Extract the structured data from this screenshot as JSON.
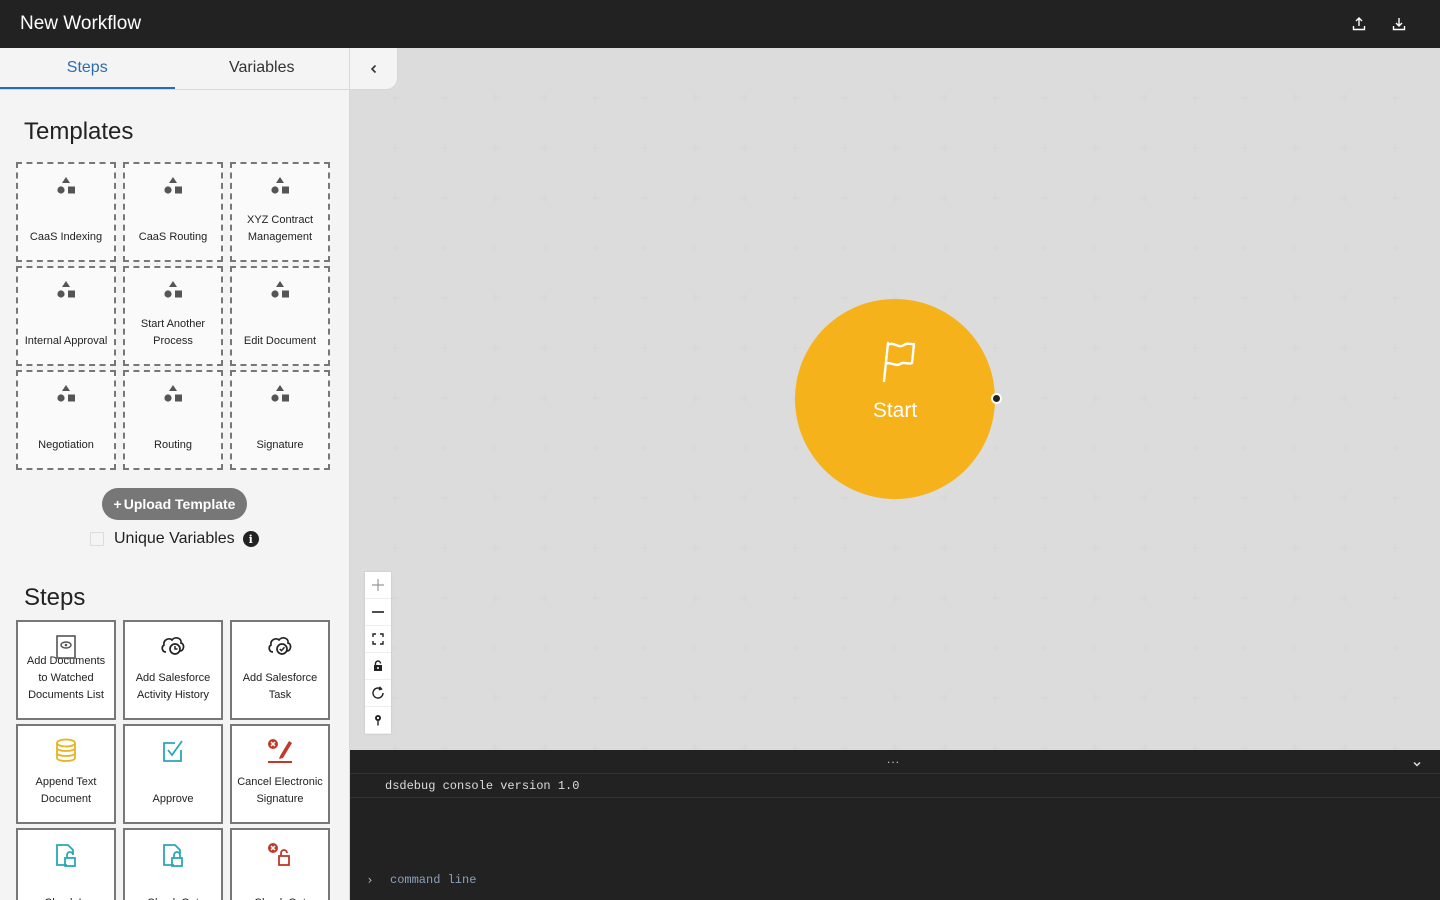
{
  "header": {
    "title": "New Workflow",
    "export_icon": "upload-icon",
    "import_icon": "download-icon"
  },
  "sidebar": {
    "tabs": [
      {
        "label": "Steps",
        "active": true
      },
      {
        "label": "Variables",
        "active": false
      }
    ],
    "templates_title": "Templates",
    "templates": [
      {
        "label": "CaaS Indexing",
        "icon": "shapes-icon"
      },
      {
        "label": "CaaS Routing",
        "icon": "shapes-icon"
      },
      {
        "label": "XYZ Contract Management",
        "icon": "shapes-icon"
      },
      {
        "label": "Internal Approval",
        "icon": "shapes-icon"
      },
      {
        "label": "Start Another Process",
        "icon": "shapes-icon"
      },
      {
        "label": "Edit Document",
        "icon": "shapes-icon"
      },
      {
        "label": "Negotiation",
        "icon": "shapes-icon"
      },
      {
        "label": "Routing",
        "icon": "shapes-icon"
      },
      {
        "label": "Signature",
        "icon": "shapes-icon"
      }
    ],
    "upload_button": "Upload Template",
    "upload_plus": "+",
    "unique_variables_label": "Unique Variables",
    "unique_variables_checked": false,
    "info_glyph": "i",
    "steps_title": "Steps",
    "steps": [
      {
        "label": "Add Documents to Watched Documents List",
        "icon": "watched-document-icon"
      },
      {
        "label": "Add Salesforce Activity History",
        "icon": "salesforce-history-icon"
      },
      {
        "label": "Add Salesforce Task",
        "icon": "salesforce-task-icon"
      },
      {
        "label": "Append Text Document",
        "icon": "database-stack-icon"
      },
      {
        "label": "Approve",
        "icon": "approve-check-icon"
      },
      {
        "label": "Cancel Electronic Signature",
        "icon": "cancel-signature-icon"
      },
      {
        "label": "Check In",
        "icon": "check-in-icon"
      },
      {
        "label": "Check Out",
        "icon": "check-out-icon"
      },
      {
        "label": "Check Out",
        "icon": "cancel-check-out-icon"
      }
    ]
  },
  "canvas": {
    "start_node": {
      "label": "Start",
      "icon": "flag-icon",
      "color": "#f5b21b"
    },
    "zoom_controls": [
      "zoom-in-icon",
      "zoom-out-icon",
      "fit-view-icon",
      "lock-icon",
      "refresh-icon",
      "pin-icon"
    ]
  },
  "console": {
    "version_line": "dsdebug console version 1.0",
    "dots": "...",
    "prompt": "›",
    "input_placeholder": "command line"
  },
  "colors": {
    "accent": "#2b6cb0",
    "start_node": "#f5b21b",
    "topbar": "#222222",
    "icon_teal": "#2aa7b5",
    "icon_red": "#c0392b",
    "icon_yellow": "#e6b422"
  }
}
